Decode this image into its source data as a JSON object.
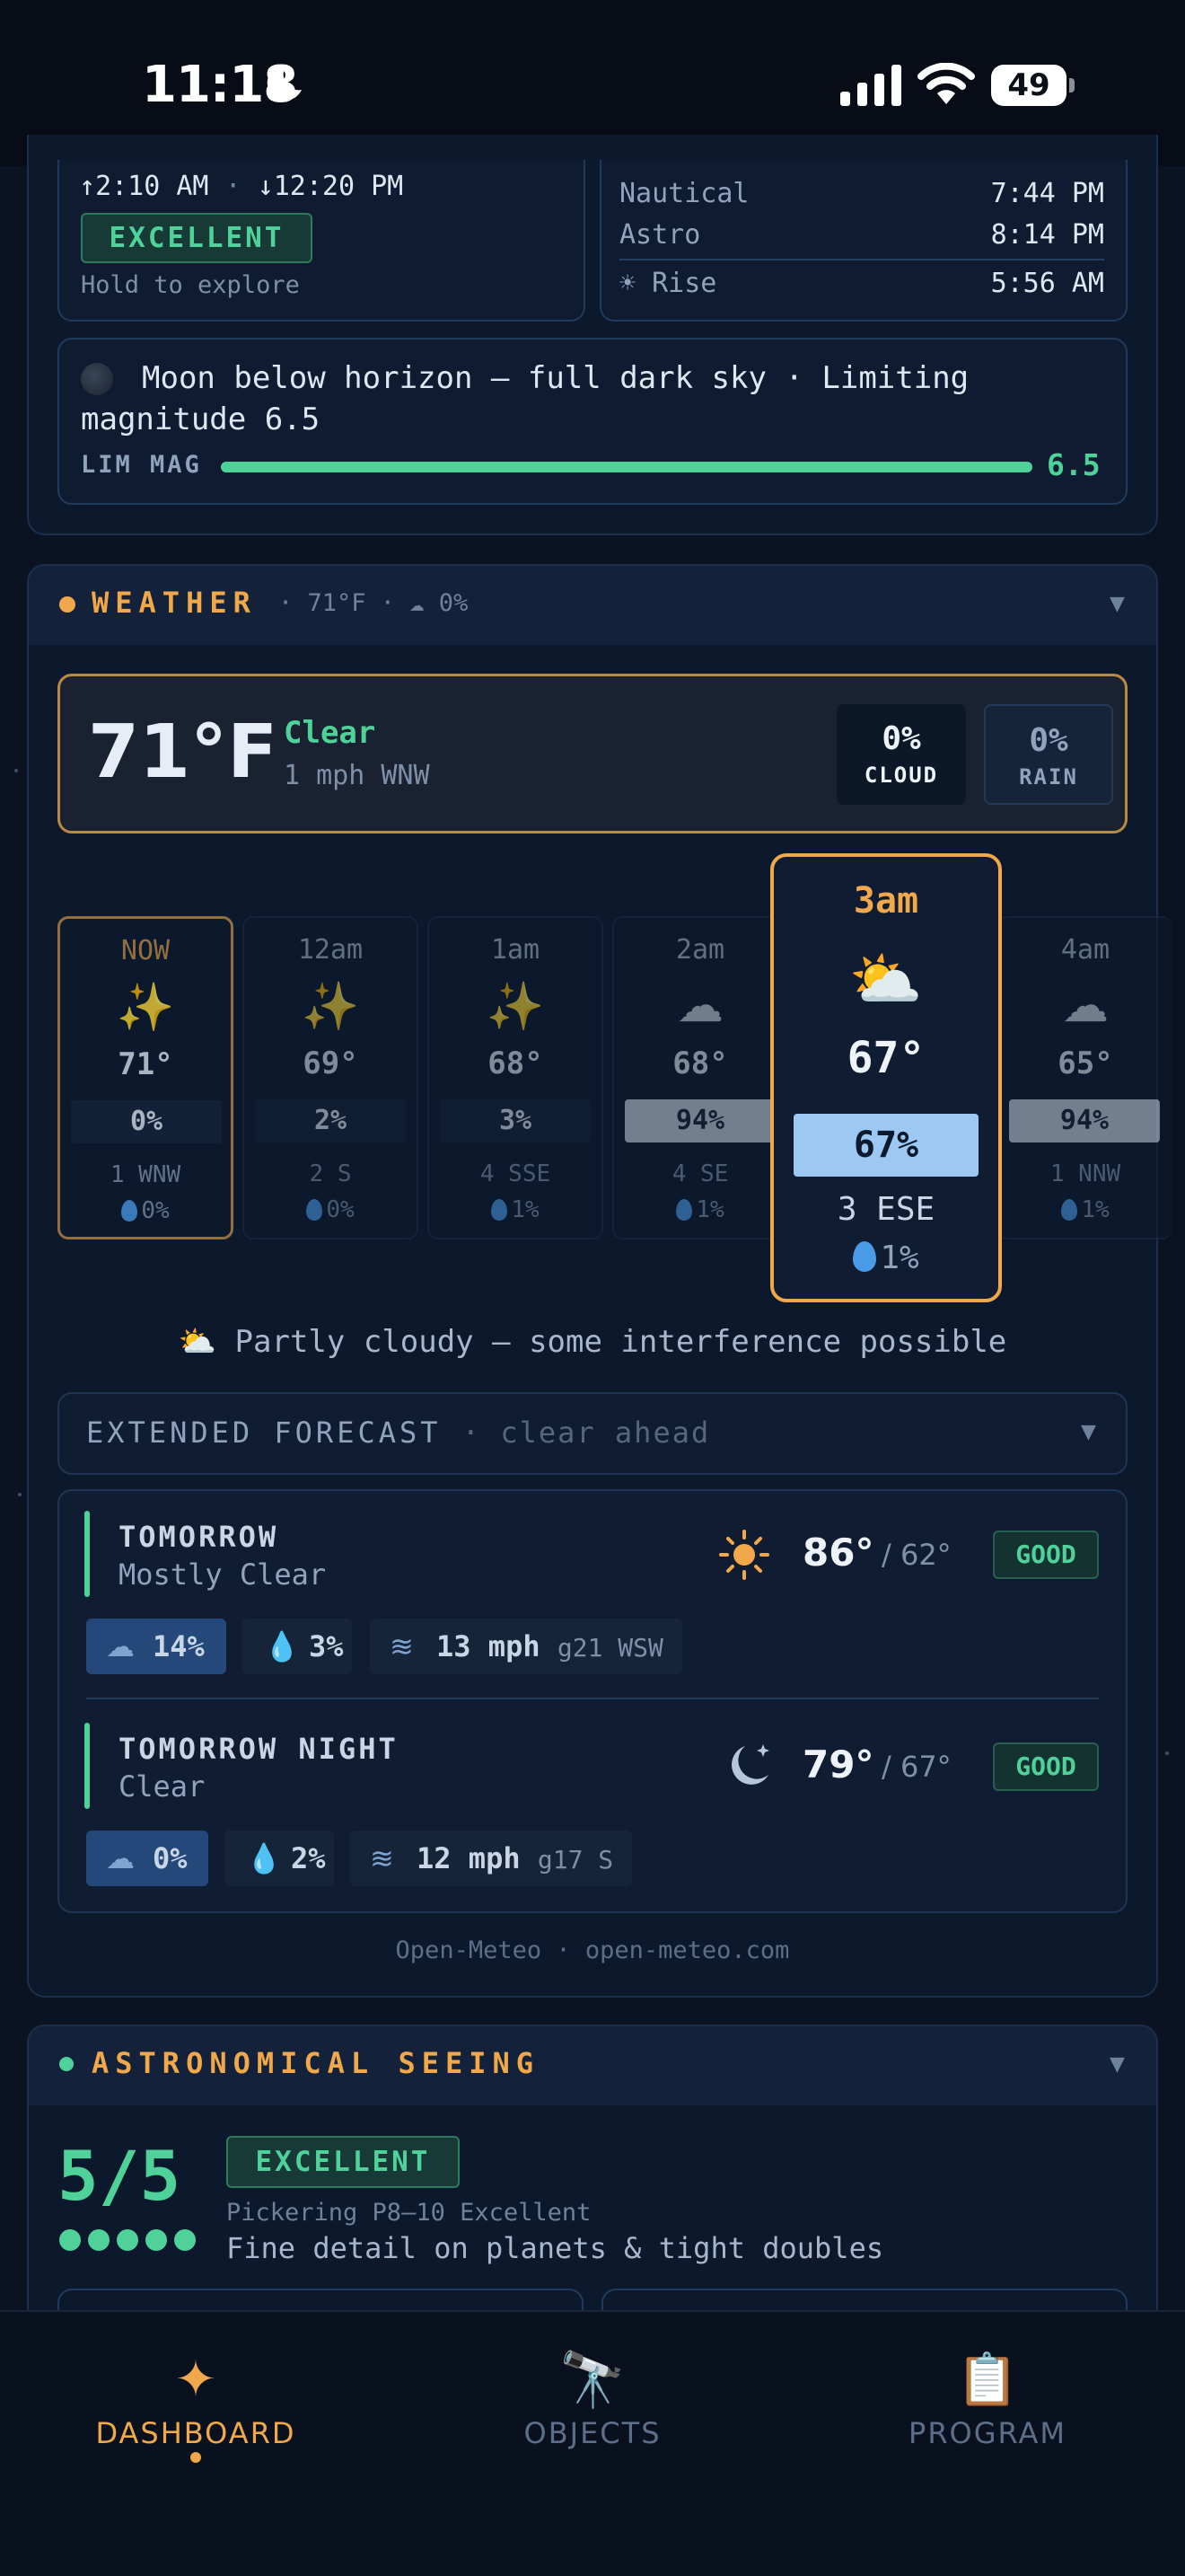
{
  "status_bar": {
    "time": "11:18",
    "battery": "49"
  },
  "rise_transit": {
    "rise_time": "2:10 AM",
    "set_time": "12:20 PM",
    "rating": "EXCELLENT",
    "hint": "Hold to explore"
  },
  "twilight": {
    "rows": [
      {
        "label": "Nautical",
        "value": "7:44 PM"
      },
      {
        "label": "Astro",
        "value": "8:14 PM"
      },
      {
        "label": "☀ Rise",
        "value": "5:56 AM"
      }
    ]
  },
  "moon": {
    "message": "Moon below horizon — full dark sky · Limiting magnitude 6.5",
    "lim_label": "LIM MAG",
    "lim_value": "6.5",
    "lim_fraction": 1.0
  },
  "weather": {
    "title": "WEATHER",
    "summary_header": "· 71°F · ☁ 0%",
    "current": {
      "temp": "71°F",
      "condition": "Clear",
      "wind": "1 mph WNW",
      "cloud_value": "0%",
      "cloud_label": "CLOUD",
      "rain_value": "0%",
      "rain_label": "RAIN"
    },
    "hourly": [
      {
        "label": "NOW",
        "icon": "✨",
        "temp": "71°",
        "cloud": "0%",
        "wind": "1 WNW",
        "rain": "0%",
        "highlight": false
      },
      {
        "label": "12am",
        "icon": "✨",
        "temp": "69°",
        "cloud": "2%",
        "wind": "2 S",
        "rain": "0%",
        "highlight": false
      },
      {
        "label": "1am",
        "icon": "✨",
        "temp": "68°",
        "cloud": "3%",
        "wind": "4 SSE",
        "rain": "1%",
        "highlight": false
      },
      {
        "label": "2am",
        "icon": "☁",
        "temp": "68°",
        "cloud": "94%",
        "wind": "4 SE",
        "rain": "1%",
        "highlight": true
      },
      {
        "label": "4am",
        "icon": "☁",
        "temp": "65°",
        "cloud": "94%",
        "wind": "1 NNW",
        "rain": "1%",
        "highlight": true
      }
    ],
    "selected_hour": {
      "label": "3am",
      "icon": "⛅",
      "temp": "67°",
      "cloud": "67%",
      "wind": "3 ESE",
      "rain": "1%"
    },
    "summary": "Partly cloudy — some interference possible",
    "summary_icon": "⛅",
    "extended": {
      "title": "EXTENDED FORECAST",
      "subtitle": "· clear ahead",
      "items": [
        {
          "name": "TOMORROW",
          "condition": "Mostly Clear",
          "icon": "sun-icon",
          "high": "86°",
          "low": "/ 62°",
          "rating": "GOOD",
          "cloud": "14%",
          "rain": "3%",
          "wind": "13 mph",
          "gust": "g21 WSW"
        },
        {
          "name": "TOMORROW NIGHT",
          "condition": "Clear",
          "icon": "moon-stars-icon",
          "high": "79°",
          "low": "/ 67°",
          "rating": "GOOD",
          "cloud": "0%",
          "rain": "2%",
          "wind": "12 mph",
          "gust": "g17 S"
        }
      ]
    },
    "source": "Open-Meteo · open-meteo.com"
  },
  "seeing": {
    "title": "ASTRONOMICAL SEEING",
    "score": "5/5",
    "score_fraction": 1.0,
    "rating": "EXCELLENT",
    "scale": "Pickering P8–10 Excellent",
    "description": "Fine detail on planets & tight doubles"
  },
  "tabs": [
    {
      "label": "DASHBOARD",
      "icon": "sparkle-icon",
      "active": true
    },
    {
      "label": "OBJECTS",
      "icon": "telescope-icon",
      "active": false
    },
    {
      "label": "PROGRAM",
      "icon": "clipboard-icon",
      "active": false
    }
  ],
  "colors": {
    "background": "#0b1322",
    "accent_orange": "#f0a84a",
    "accent_green": "#4fd29a",
    "panel": "#0f1c31"
  }
}
